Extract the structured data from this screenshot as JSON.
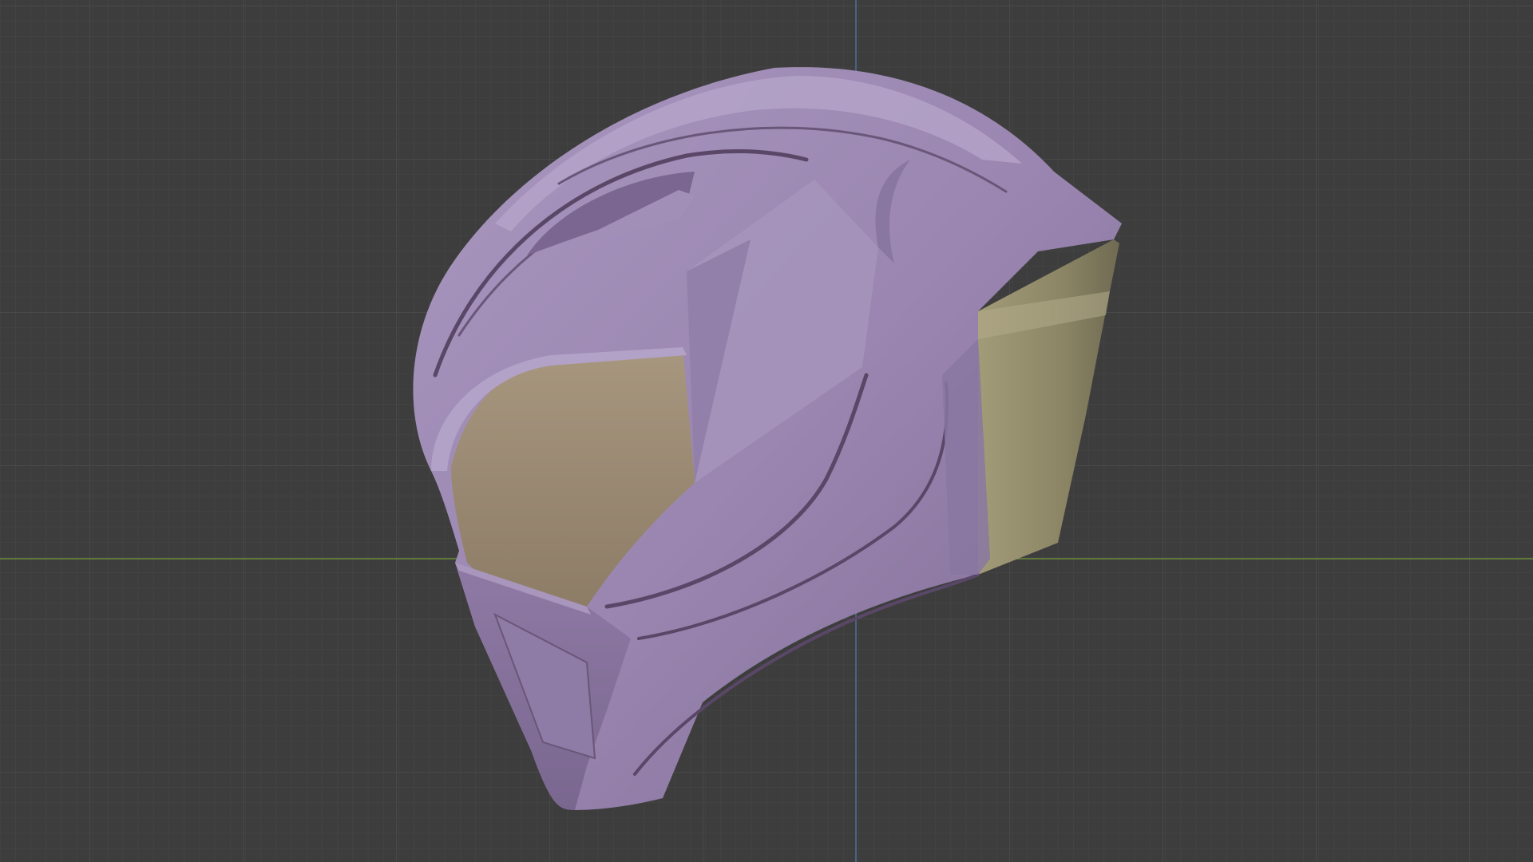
{
  "viewport": {
    "mode": "3d-viewport-orthographic-side",
    "background_color": "#3d3d3d",
    "grid_minor_color": "#474747",
    "grid_major_color": "#4c4c4c",
    "axis_x_color": "#6c8c3a",
    "axis_z_color": "#4a6e98"
  },
  "object": {
    "name": "helmet-model",
    "shell_color": "#9a86b0",
    "shell_shadow_color": "#7d6a92",
    "shell_highlight_color": "#b19fc4",
    "visor_color": "#a08f79",
    "visor_shadow_color": "#8a7a63",
    "rear_insert_color": "#8a8465",
    "rear_insert_highlight": "#a7a07e",
    "groove_color": "#5a4767"
  }
}
